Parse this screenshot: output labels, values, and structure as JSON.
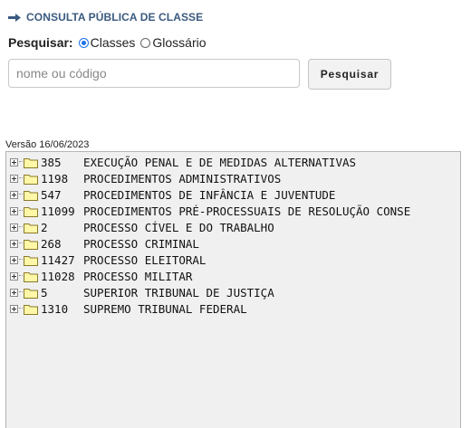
{
  "header": {
    "icon": "arrow-right-icon",
    "title": "CONSULTA PÚBLICA DE CLASSE"
  },
  "search": {
    "label": "Pesquisar:",
    "options": [
      {
        "label": "Classes",
        "checked": true
      },
      {
        "label": "Glossário",
        "checked": false
      }
    ],
    "placeholder": "nome ou código",
    "button_label": "Pesquisar"
  },
  "version": "Versão 16/06/2023",
  "tree": {
    "items": [
      {
        "code": "385",
        "name": "EXECUÇÃO PENAL E DE MEDIDAS ALTERNATIVAS"
      },
      {
        "code": "1198",
        "name": "PROCEDIMENTOS ADMINISTRATIVOS"
      },
      {
        "code": "547",
        "name": "PROCEDIMENTOS DE INFÂNCIA E JUVENTUDE"
      },
      {
        "code": "11099",
        "name": "PROCEDIMENTOS PRÉ-PROCESSUAIS DE RESOLUÇÃO CONSE"
      },
      {
        "code": "2",
        "name": "PROCESSO CÍVEL E DO TRABALHO"
      },
      {
        "code": "268",
        "name": "PROCESSO CRIMINAL"
      },
      {
        "code": "11427",
        "name": "PROCESSO ELEITORAL"
      },
      {
        "code": "11028",
        "name": "PROCESSO MILITAR"
      },
      {
        "code": "5",
        "name": "SUPERIOR TRIBUNAL DE JUSTIÇA"
      },
      {
        "code": "1310",
        "name": "SUPREMO TRIBUNAL FEDERAL"
      }
    ]
  },
  "colors": {
    "header_text": "#3a5a80",
    "radio_accent": "#1a73e8",
    "folder_fill": "#fff7a8",
    "tree_background": "#f0f0f0"
  }
}
